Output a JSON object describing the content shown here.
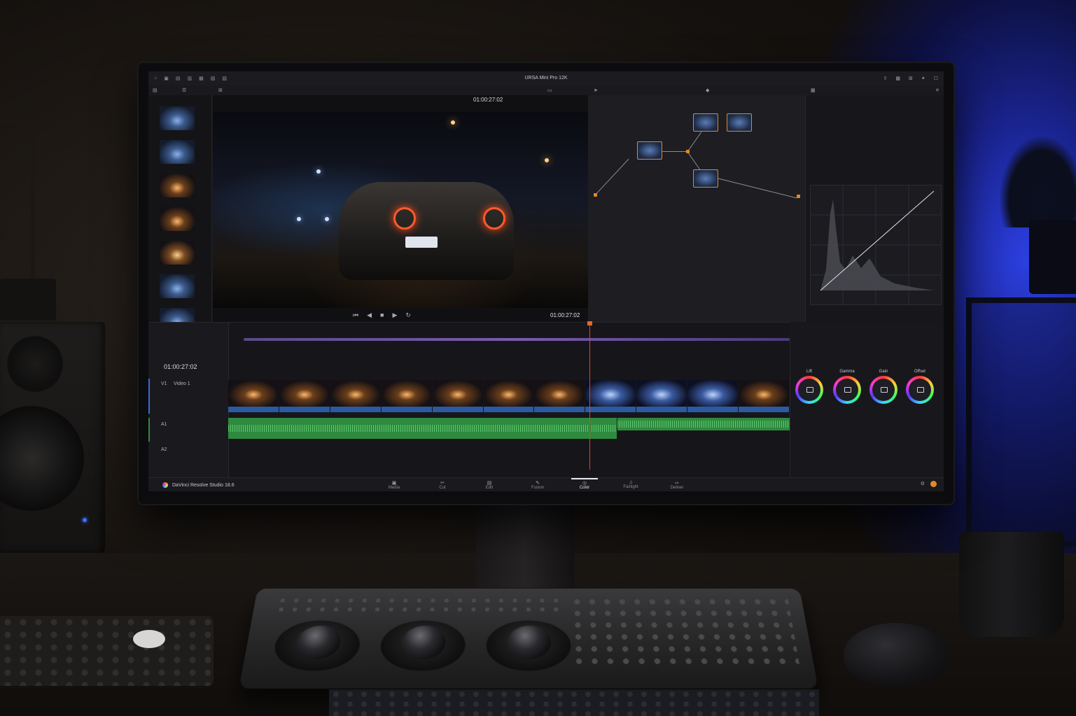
{
  "window": {
    "title": "URSA Mini Pro 12K"
  },
  "viewer": {
    "timecode_top": "01:00:27:02",
    "timecode_bottom": "01:00:27:02"
  },
  "timeline": {
    "timecode_main": "01:00:27:02",
    "tracks": [
      {
        "id": "V1",
        "name": "Video 1"
      },
      {
        "id": "A1",
        "name": ""
      },
      {
        "id": "A2",
        "name": ""
      }
    ]
  },
  "color_wheels": {
    "wheels": [
      "Lift",
      "Gamma",
      "Gain",
      "Offset"
    ]
  },
  "page_bar": {
    "brand": "DaVinci Resolve Studio 18.6",
    "pages": [
      "Media",
      "Cut",
      "Edit",
      "Fusion",
      "Color",
      "Fairlight",
      "Deliver"
    ],
    "active_page": "Color"
  },
  "colors": {
    "accent": "#e06a2a",
    "clip_bar": "#2c5aa0",
    "audio": "#2e8a3e",
    "ambient_blue": "#2c3fe0"
  },
  "icons": [
    "search-icon",
    "play-icon",
    "stop-icon",
    "skip-back-icon",
    "skip-forward-icon",
    "loop-icon",
    "settings-icon",
    "home-icon"
  ]
}
